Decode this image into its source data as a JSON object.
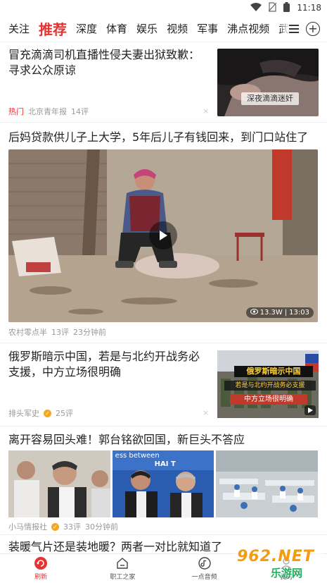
{
  "status_bar": {
    "time": "11:18",
    "icons": [
      "wifi-icon",
      "no-sim-icon",
      "battery-icon"
    ]
  },
  "tabs": [
    {
      "label": "关注"
    },
    {
      "label": "推荐",
      "active": true
    },
    {
      "label": "深度"
    },
    {
      "label": "体育"
    },
    {
      "label": "娱乐"
    },
    {
      "label": "视频"
    },
    {
      "label": "军事"
    },
    {
      "label": "沸点视频"
    },
    {
      "label": "武"
    }
  ],
  "tab_actions": {
    "menu_icon": "menu-icon",
    "add_icon": "plus-circle-icon"
  },
  "feed": {
    "item1": {
      "title": "冒充滴滴司机直播性侵夫妻出狱致歉：寻求公众原谅",
      "tag": "热门",
      "source": "北京青年报",
      "comments": "14评",
      "thumb_caption": "深夜滴滴迷奸"
    },
    "item2": {
      "title": "后妈贷款供儿子上大学，5年后儿子有钱回来，到门口站住了",
      "views": "13.3W",
      "duration": "13:03",
      "source": "农村零点半",
      "comments": "13评",
      "time": "23分钟前"
    },
    "item3": {
      "title": "俄罗斯暗示中国，若是与北约开战务必支援，中方立场很明确",
      "source": "排头军史",
      "comments": "25评",
      "thumb_text_1": "俄罗斯暗示中国",
      "thumb_text_2": "若是与北约开战务必支援",
      "thumb_text_3": "中方立场很明确"
    },
    "item4": {
      "title": "离开容易回头难！郭台铭欲回国，新巨头不答应",
      "source": "小马情报社",
      "comments": "33评",
      "time": "30分钟前",
      "img2_text": "ess between",
      "img2_text_b": "HAI T"
    },
    "item5": {
      "title": "装暖气片还是装地暖？两者一对比就知道了"
    }
  },
  "bottom_nav": [
    {
      "label": "刷新",
      "icon": "refresh-icon",
      "active": true
    },
    {
      "label": "职工之家",
      "icon": "home-icon"
    },
    {
      "label": "一点音频",
      "icon": "audio-icon"
    },
    {
      "label": "我的",
      "icon": "profile-icon"
    }
  ],
  "watermark": {
    "text_1": "962.NET",
    "text_2": "乐游网"
  },
  "colors": {
    "accent": "#e63232",
    "text": "#222222",
    "meta": "#999999"
  }
}
